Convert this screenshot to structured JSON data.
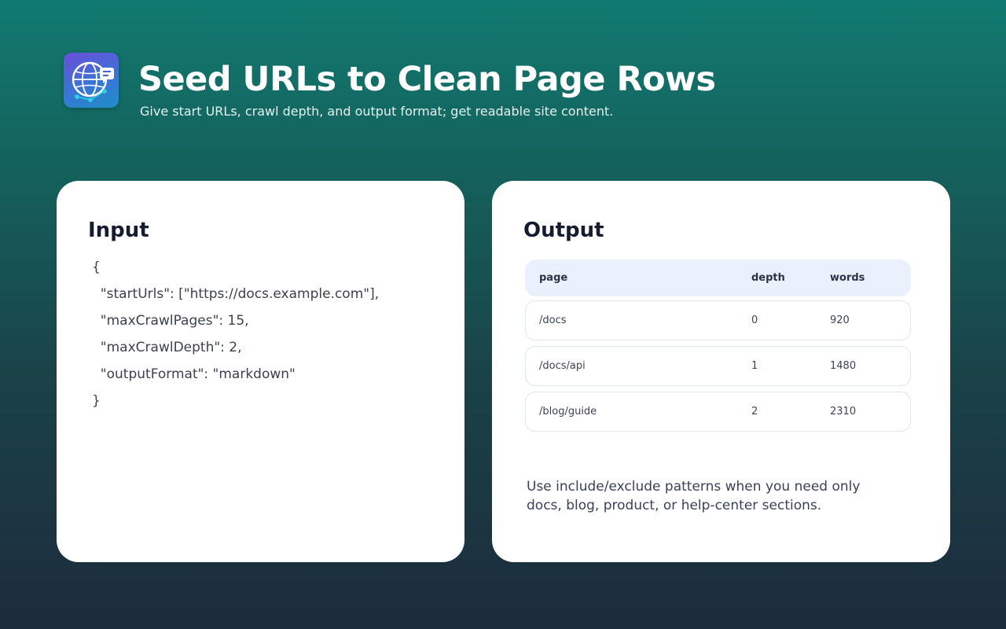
{
  "header": {
    "title": "Seed URLs to Clean Page Rows",
    "subtitle": "Give start URLs, crawl depth, and output format; get readable site content.",
    "logo_icon": "globe-chat-icon"
  },
  "input_card": {
    "heading": "Input",
    "code_lines": [
      "{",
      "  \"startUrls\": [\"https://docs.example.com\"],",
      "  \"maxCrawlPages\": 15,",
      "  \"maxCrawlDepth\": 2,",
      "  \"outputFormat\": \"markdown\"",
      "}"
    ]
  },
  "output_card": {
    "heading": "Output",
    "table": {
      "columns": [
        "page",
        "depth",
        "words"
      ],
      "rows": [
        {
          "page": "/docs",
          "depth": "0",
          "words": "920"
        },
        {
          "page": "/docs/api",
          "depth": "1",
          "words": "1480"
        },
        {
          "page": "/blog/guide",
          "depth": "2",
          "words": "2310"
        }
      ]
    },
    "note": "Use include/exclude patterns when you need only docs, blog, product, or help-center sections."
  },
  "colors": {
    "background_top": "#117a70",
    "background_bottom": "#1d2b3c",
    "card": "#ffffff",
    "table_header": "#eaf1fc",
    "heading_text": "#141c30"
  }
}
